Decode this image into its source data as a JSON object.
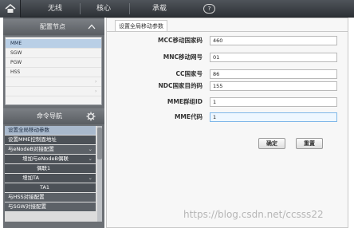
{
  "topnav": {
    "home_icon": "home-icon",
    "items": [
      "无线",
      "核心",
      "承载"
    ],
    "help_label": "?"
  },
  "sidebar": {
    "config_nodes_title": "配置节点",
    "nodes": [
      "MME",
      "SGW",
      "PGW",
      "HSS"
    ],
    "command_nav_title": "命令导航",
    "commands": [
      "设置全局移动参数",
      "设置MME控制面地址",
      "与eNodeB对接配置",
      "增加与eNodeB偶联",
      "偶联1",
      "增加TA",
      "TA1",
      "与HSS对接配置",
      "与SGW对接配置"
    ]
  },
  "main": {
    "tab_label": "设置全局移动参数",
    "fields": [
      {
        "label": "MCC移动国家码",
        "value": "460"
      },
      {
        "label": "MNC移动网号",
        "value": "01"
      },
      {
        "label": "CC国家号",
        "value": "86"
      },
      {
        "label": "NDC国家目的码",
        "value": "155"
      },
      {
        "label": "MME群组ID",
        "value": "1"
      },
      {
        "label": "MME代码",
        "value": "1"
      }
    ],
    "confirm_label": "确定",
    "reset_label": "重置"
  },
  "watermark": "https://blog.csdn.net/ccsss22",
  "colors": {
    "topbar": "#3a3e44",
    "sidebar": "#6b6f74",
    "selected_node": "#b9cfe6",
    "selected_command": "#a9b9cc",
    "focus_border": "#7fb7e8"
  }
}
